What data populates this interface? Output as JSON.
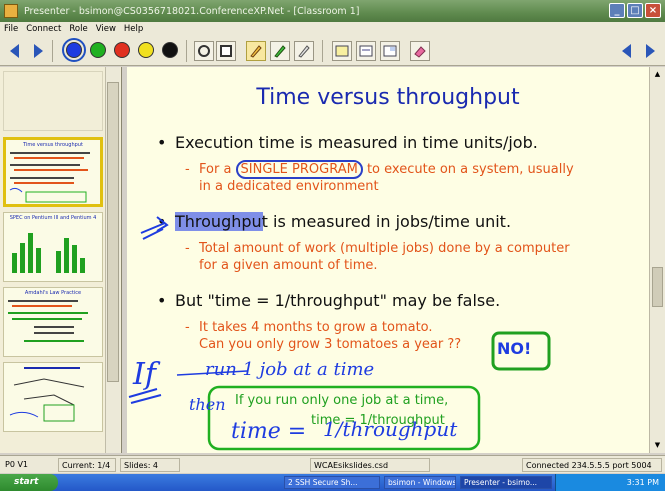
{
  "window": {
    "title": "Presenter - bsimon@CS0356718021.ConferenceXP.Net - [Classroom 1]",
    "colors": {
      "titlebar": "#5f8a4e",
      "slide_bg": "#fefee4",
      "title_text": "#1a2ab0",
      "sub_text": "#e2541a"
    }
  },
  "menu": {
    "items": [
      "File",
      "Connect",
      "Role",
      "View",
      "Help"
    ]
  },
  "toolbar": {
    "pen_colors": [
      "#1e3ce0",
      "#20b020",
      "#e03020",
      "#f0e020",
      "#111111"
    ],
    "tools": [
      "rectangle-select-icon",
      "square-icon",
      "pen-icon",
      "highlighter-icon",
      "eraser-pen-icon",
      "slide-view-icon",
      "whiteboard-icon",
      "minimize-slide-icon",
      "eraser-icon"
    ]
  },
  "slide": {
    "title": "Time versus throughput",
    "bullets": [
      {
        "text": "Execution time is measured in time units/job."
      },
      {
        "text": "Throughput is measured in jobs/time unit."
      },
      {
        "text": "But \"time = 1/throughput\" may be false."
      }
    ],
    "subs": [
      {
        "prefix": "For a ",
        "circled": "SINGLE PROGRAM",
        "suffix": " to execute on a system, usually",
        "line2": "in a dedicated environment"
      },
      {
        "line1": "Total amount of work (multiple jobs) done by a computer",
        "line2": "for a given amount of time."
      },
      {
        "line1": "It takes 4 months to grow a tomato.",
        "line2": "Can you only grow 3 tomatoes a year ??"
      }
    ],
    "ink": {
      "if": "If",
      "run_one_job": "run 1 job at a time",
      "then": "then",
      "time_eq": "time =",
      "one_over_throughput": "1/throughput",
      "no": "NO!",
      "box_text_1": "If you run only one job at a time,",
      "box_text_2": "time = 1/throughput"
    }
  },
  "thumbnails": [
    {
      "title": "Time versus throughput"
    },
    {
      "title": "SPEC on Pentium III and Pentium 4"
    },
    {
      "title": "Amdahl's Law Practice"
    },
    {
      "title": ""
    }
  ],
  "status": {
    "pov": "P0 V1",
    "current": "Current: 1/4",
    "slides": "Slides: 4",
    "deck": "WCAEsikslides.csd",
    "connection": "Connected 234.5.5.5 port 5004"
  },
  "taskbar": {
    "start": "start",
    "tasks": [
      "2 SSH Secure Sh...",
      "bsimon - Windows...",
      "Presenter - bsimo..."
    ],
    "clock": "3:31 PM"
  }
}
